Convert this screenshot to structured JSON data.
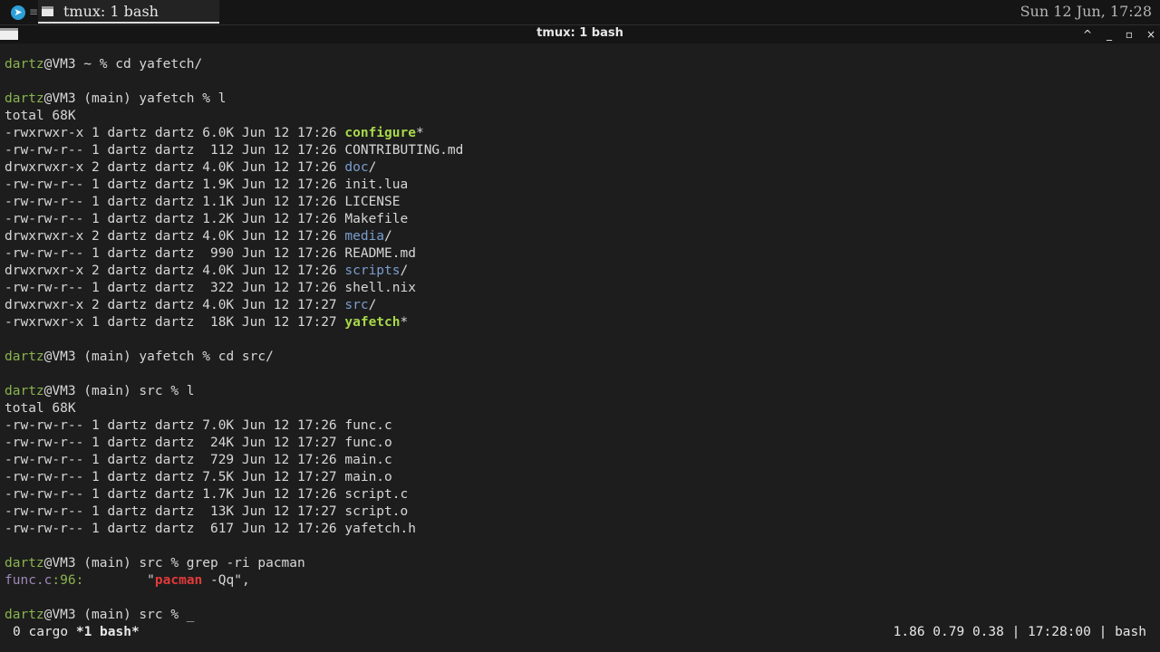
{
  "panel": {
    "launcher_icon": "app-launcher-icon",
    "menu_glyph": "≡",
    "task_label": "tmux: 1 bash",
    "clock": "Sun 12 Jun, 17:28"
  },
  "window": {
    "title": "tmux: 1 bash",
    "buttons": {
      "shade": "^",
      "minimize": "_",
      "maximize": "▫",
      "close": "×"
    }
  },
  "terminal": {
    "prompt_user": "dartz",
    "prompts": {
      "p1": "@VM3 ~ % ",
      "p2": "@VM3 (main) yafetch % ",
      "p3": "@VM3 (main) yafetch % ",
      "p4": "@VM3 (main) src % ",
      "p5": "@VM3 (main) src % ",
      "p6": "@VM3 (main) src % "
    },
    "commands": {
      "c1": "cd yafetch/",
      "c2": "l",
      "c3": "cd src/",
      "c4": "l",
      "c5": "grep -ri pacman",
      "c6": ""
    },
    "cursor": "_",
    "total1": "total 68K",
    "listing1": [
      {
        "meta": "-rwxrwxr-x 1 dartz dartz 6.0K Jun 12 17:26 ",
        "name": "configure",
        "kind": "exe",
        "suffix": "*"
      },
      {
        "meta": "-rw-rw-r-- 1 dartz dartz  112 Jun 12 17:26 ",
        "name": "CONTRIBUTING.md",
        "kind": "file",
        "suffix": ""
      },
      {
        "meta": "drwxrwxr-x 2 dartz dartz 4.0K Jun 12 17:26 ",
        "name": "doc",
        "kind": "dir",
        "suffix": "/"
      },
      {
        "meta": "-rw-rw-r-- 1 dartz dartz 1.9K Jun 12 17:26 ",
        "name": "init.lua",
        "kind": "file",
        "suffix": ""
      },
      {
        "meta": "-rw-rw-r-- 1 dartz dartz 1.1K Jun 12 17:26 ",
        "name": "LICENSE",
        "kind": "file",
        "suffix": ""
      },
      {
        "meta": "-rw-rw-r-- 1 dartz dartz 1.2K Jun 12 17:26 ",
        "name": "Makefile",
        "kind": "file",
        "suffix": ""
      },
      {
        "meta": "drwxrwxr-x 2 dartz dartz 4.0K Jun 12 17:26 ",
        "name": "media",
        "kind": "dir",
        "suffix": "/"
      },
      {
        "meta": "-rw-rw-r-- 1 dartz dartz  990 Jun 12 17:26 ",
        "name": "README.md",
        "kind": "file",
        "suffix": ""
      },
      {
        "meta": "drwxrwxr-x 2 dartz dartz 4.0K Jun 12 17:26 ",
        "name": "scripts",
        "kind": "dir",
        "suffix": "/"
      },
      {
        "meta": "-rw-rw-r-- 1 dartz dartz  322 Jun 12 17:26 ",
        "name": "shell.nix",
        "kind": "file",
        "suffix": ""
      },
      {
        "meta": "drwxrwxr-x 2 dartz dartz 4.0K Jun 12 17:27 ",
        "name": "src",
        "kind": "dir",
        "suffix": "/"
      },
      {
        "meta": "-rwxrwxr-x 1 dartz dartz  18K Jun 12 17:27 ",
        "name": "yafetch",
        "kind": "exe",
        "suffix": "*"
      }
    ],
    "total2": "total 68K",
    "listing2": [
      {
        "meta": "-rw-rw-r-- 1 dartz dartz 7.0K Jun 12 17:26 ",
        "name": "func.c",
        "kind": "file",
        "suffix": ""
      },
      {
        "meta": "-rw-rw-r-- 1 dartz dartz  24K Jun 12 17:27 ",
        "name": "func.o",
        "kind": "file",
        "suffix": ""
      },
      {
        "meta": "-rw-rw-r-- 1 dartz dartz  729 Jun 12 17:26 ",
        "name": "main.c",
        "kind": "file",
        "suffix": ""
      },
      {
        "meta": "-rw-rw-r-- 1 dartz dartz 7.5K Jun 12 17:27 ",
        "name": "main.o",
        "kind": "file",
        "suffix": ""
      },
      {
        "meta": "-rw-rw-r-- 1 dartz dartz 1.7K Jun 12 17:26 ",
        "name": "script.c",
        "kind": "file",
        "suffix": ""
      },
      {
        "meta": "-rw-rw-r-- 1 dartz dartz  13K Jun 12 17:27 ",
        "name": "script.o",
        "kind": "file",
        "suffix": ""
      },
      {
        "meta": "-rw-rw-r-- 1 dartz dartz  617 Jun 12 17:26 ",
        "name": "yafetch.h",
        "kind": "file",
        "suffix": ""
      }
    ],
    "grep_result": {
      "file": "func.c",
      "sep1": ":",
      "line": "96",
      "sep2": ":",
      "pad": "        ",
      "pre": "\"",
      "match": "pacman",
      "post": " -Qq\","
    }
  },
  "tmux": {
    "window_list": [
      {
        "text": "0 cargo",
        "active": false
      },
      {
        "text": "*1 bash*",
        "active": true
      }
    ],
    "status_right": "1.86 0.79 0.38 | 17:28:00 | bash"
  },
  "colors": {
    "background": "#1d1d1d",
    "text": "#d7d7d7",
    "user": "#8ab44f",
    "executable": "#a7d84a",
    "directory": "#7a9dcf",
    "grep_file": "#a087b8",
    "grep_match": "#e23a3a"
  }
}
